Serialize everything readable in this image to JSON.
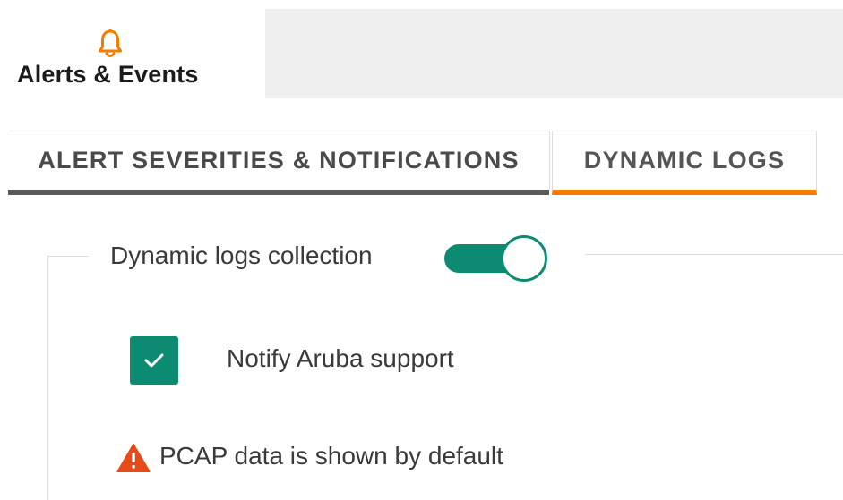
{
  "nav": {
    "label": "Alerts & Events",
    "icon": "bell-icon",
    "icon_color": "#f57c00"
  },
  "tabs": [
    {
      "label": "ALERT SEVERITIES & NOTIFICATIONS",
      "active": false
    },
    {
      "label": "DYNAMIC LOGS",
      "active": true
    }
  ],
  "dynamic_logs": {
    "collection_label": "Dynamic logs collection",
    "collection_enabled": true,
    "notify_label": "Notify Aruba support",
    "notify_checked": true,
    "warning_text": "PCAP data is shown by default",
    "warning_icon": "warning-triangle-icon"
  },
  "colors": {
    "accent": "#0d8a72",
    "active_tab": "#f57c00",
    "inactive_tab": "#5a5a5a",
    "warning": "#e64a19"
  }
}
